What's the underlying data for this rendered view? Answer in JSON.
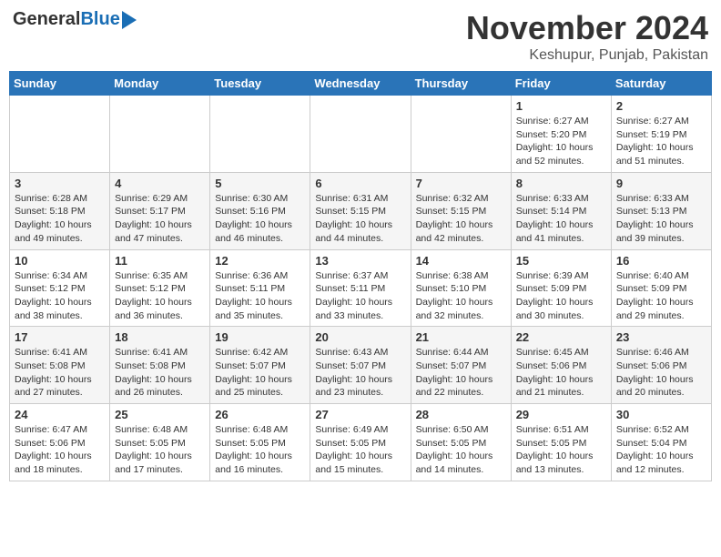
{
  "header": {
    "logo_general": "General",
    "logo_blue": "Blue",
    "month_title": "November 2024",
    "location": "Keshupur, Punjab, Pakistan"
  },
  "weekdays": [
    "Sunday",
    "Monday",
    "Tuesday",
    "Wednesday",
    "Thursday",
    "Friday",
    "Saturday"
  ],
  "weeks": [
    [
      {
        "day": "",
        "info": ""
      },
      {
        "day": "",
        "info": ""
      },
      {
        "day": "",
        "info": ""
      },
      {
        "day": "",
        "info": ""
      },
      {
        "day": "",
        "info": ""
      },
      {
        "day": "1",
        "info": "Sunrise: 6:27 AM\nSunset: 5:20 PM\nDaylight: 10 hours and 52 minutes."
      },
      {
        "day": "2",
        "info": "Sunrise: 6:27 AM\nSunset: 5:19 PM\nDaylight: 10 hours and 51 minutes."
      }
    ],
    [
      {
        "day": "3",
        "info": "Sunrise: 6:28 AM\nSunset: 5:18 PM\nDaylight: 10 hours and 49 minutes."
      },
      {
        "day": "4",
        "info": "Sunrise: 6:29 AM\nSunset: 5:17 PM\nDaylight: 10 hours and 47 minutes."
      },
      {
        "day": "5",
        "info": "Sunrise: 6:30 AM\nSunset: 5:16 PM\nDaylight: 10 hours and 46 minutes."
      },
      {
        "day": "6",
        "info": "Sunrise: 6:31 AM\nSunset: 5:15 PM\nDaylight: 10 hours and 44 minutes."
      },
      {
        "day": "7",
        "info": "Sunrise: 6:32 AM\nSunset: 5:15 PM\nDaylight: 10 hours and 42 minutes."
      },
      {
        "day": "8",
        "info": "Sunrise: 6:33 AM\nSunset: 5:14 PM\nDaylight: 10 hours and 41 minutes."
      },
      {
        "day": "9",
        "info": "Sunrise: 6:33 AM\nSunset: 5:13 PM\nDaylight: 10 hours and 39 minutes."
      }
    ],
    [
      {
        "day": "10",
        "info": "Sunrise: 6:34 AM\nSunset: 5:12 PM\nDaylight: 10 hours and 38 minutes."
      },
      {
        "day": "11",
        "info": "Sunrise: 6:35 AM\nSunset: 5:12 PM\nDaylight: 10 hours and 36 minutes."
      },
      {
        "day": "12",
        "info": "Sunrise: 6:36 AM\nSunset: 5:11 PM\nDaylight: 10 hours and 35 minutes."
      },
      {
        "day": "13",
        "info": "Sunrise: 6:37 AM\nSunset: 5:11 PM\nDaylight: 10 hours and 33 minutes."
      },
      {
        "day": "14",
        "info": "Sunrise: 6:38 AM\nSunset: 5:10 PM\nDaylight: 10 hours and 32 minutes."
      },
      {
        "day": "15",
        "info": "Sunrise: 6:39 AM\nSunset: 5:09 PM\nDaylight: 10 hours and 30 minutes."
      },
      {
        "day": "16",
        "info": "Sunrise: 6:40 AM\nSunset: 5:09 PM\nDaylight: 10 hours and 29 minutes."
      }
    ],
    [
      {
        "day": "17",
        "info": "Sunrise: 6:41 AM\nSunset: 5:08 PM\nDaylight: 10 hours and 27 minutes."
      },
      {
        "day": "18",
        "info": "Sunrise: 6:41 AM\nSunset: 5:08 PM\nDaylight: 10 hours and 26 minutes."
      },
      {
        "day": "19",
        "info": "Sunrise: 6:42 AM\nSunset: 5:07 PM\nDaylight: 10 hours and 25 minutes."
      },
      {
        "day": "20",
        "info": "Sunrise: 6:43 AM\nSunset: 5:07 PM\nDaylight: 10 hours and 23 minutes."
      },
      {
        "day": "21",
        "info": "Sunrise: 6:44 AM\nSunset: 5:07 PM\nDaylight: 10 hours and 22 minutes."
      },
      {
        "day": "22",
        "info": "Sunrise: 6:45 AM\nSunset: 5:06 PM\nDaylight: 10 hours and 21 minutes."
      },
      {
        "day": "23",
        "info": "Sunrise: 6:46 AM\nSunset: 5:06 PM\nDaylight: 10 hours and 20 minutes."
      }
    ],
    [
      {
        "day": "24",
        "info": "Sunrise: 6:47 AM\nSunset: 5:06 PM\nDaylight: 10 hours and 18 minutes."
      },
      {
        "day": "25",
        "info": "Sunrise: 6:48 AM\nSunset: 5:05 PM\nDaylight: 10 hours and 17 minutes."
      },
      {
        "day": "26",
        "info": "Sunrise: 6:48 AM\nSunset: 5:05 PM\nDaylight: 10 hours and 16 minutes."
      },
      {
        "day": "27",
        "info": "Sunrise: 6:49 AM\nSunset: 5:05 PM\nDaylight: 10 hours and 15 minutes."
      },
      {
        "day": "28",
        "info": "Sunrise: 6:50 AM\nSunset: 5:05 PM\nDaylight: 10 hours and 14 minutes."
      },
      {
        "day": "29",
        "info": "Sunrise: 6:51 AM\nSunset: 5:05 PM\nDaylight: 10 hours and 13 minutes."
      },
      {
        "day": "30",
        "info": "Sunrise: 6:52 AM\nSunset: 5:04 PM\nDaylight: 10 hours and 12 minutes."
      }
    ]
  ]
}
